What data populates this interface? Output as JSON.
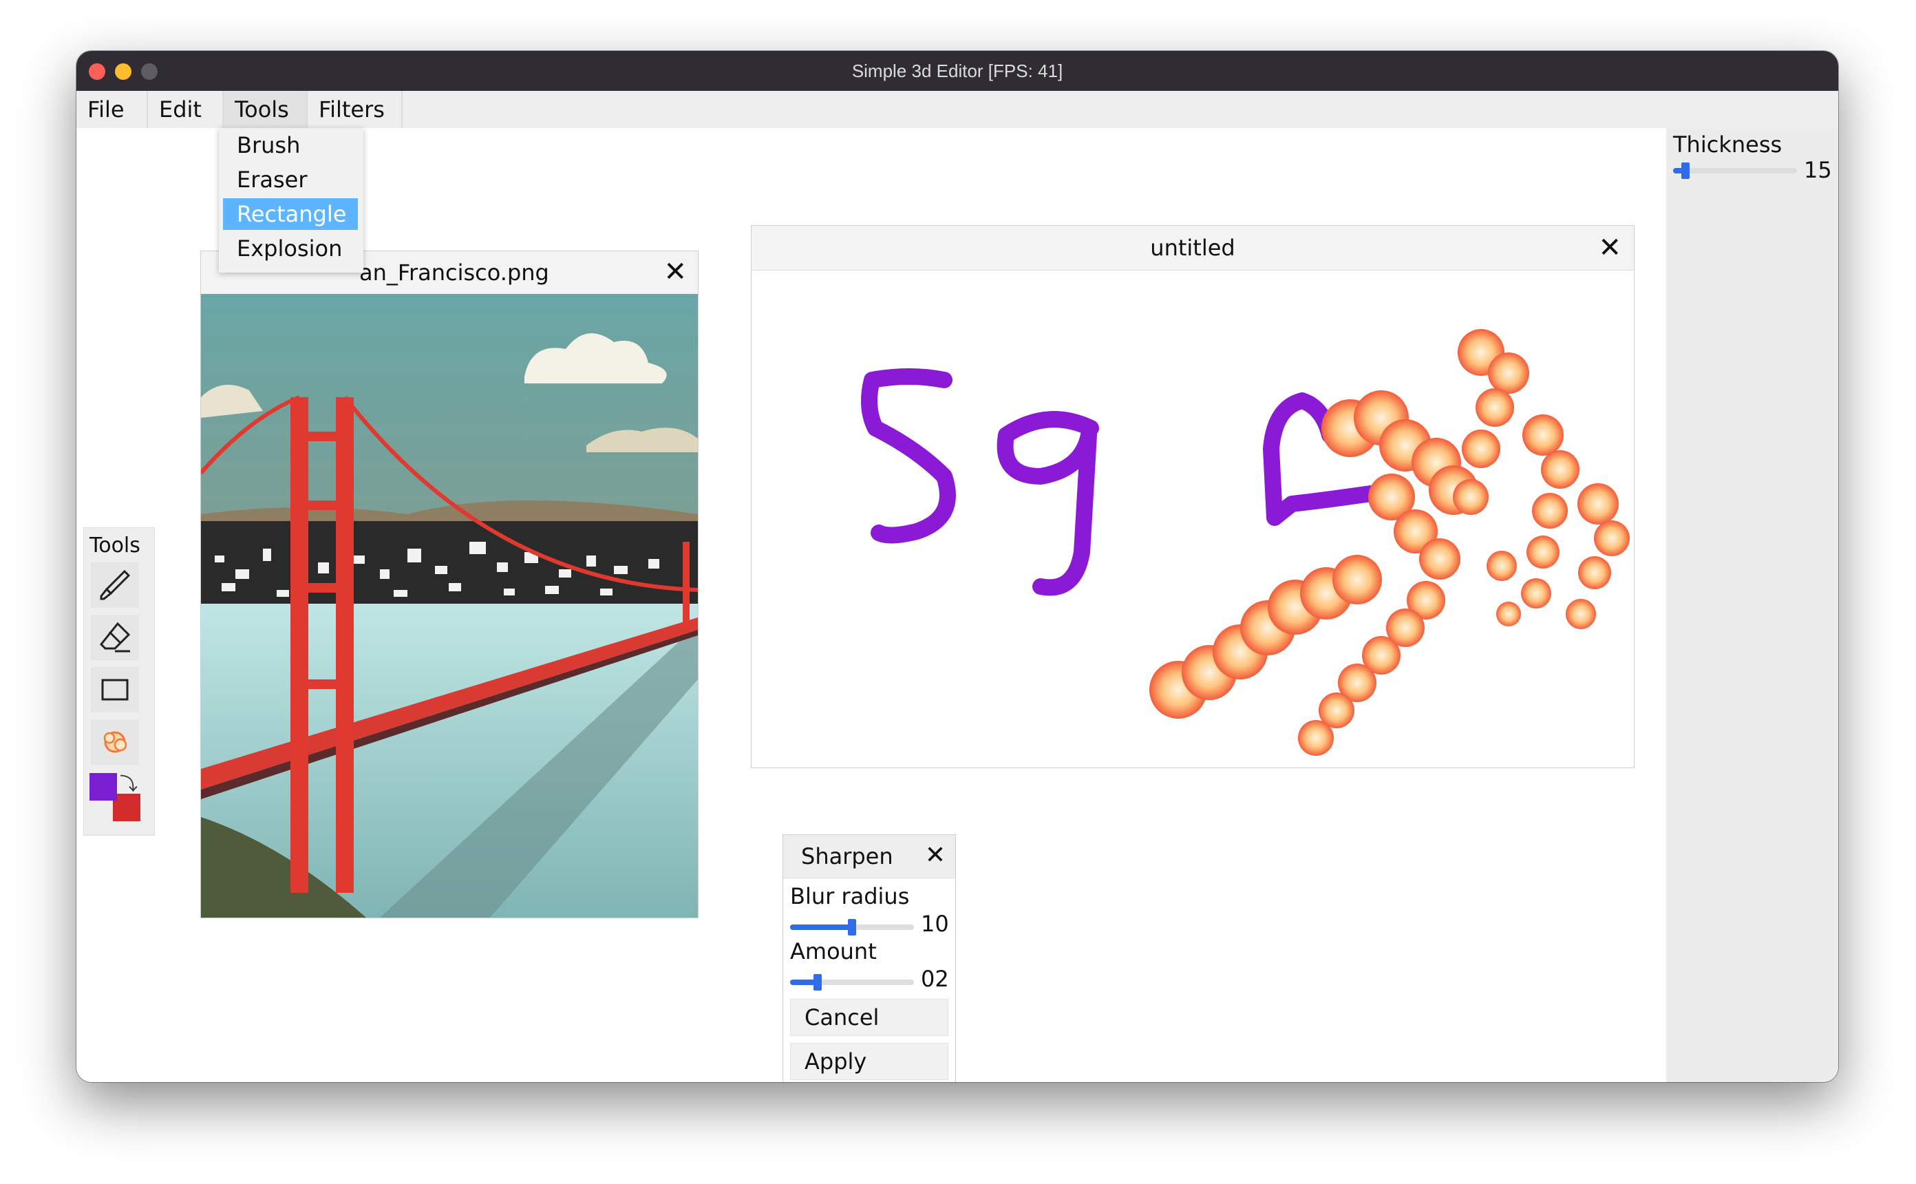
{
  "window": {
    "title": "Simple 3d Editor [FPS: 41]"
  },
  "menubar": {
    "items": [
      "File",
      "Edit",
      "Tools",
      "Filters"
    ],
    "active": "Tools"
  },
  "tools_menu": {
    "items": [
      "Brush",
      "Eraser",
      "Rectangle",
      "Explosion"
    ],
    "selected": "Rectangle"
  },
  "tools_panel": {
    "title": "Tools",
    "tools": [
      "brush-icon",
      "eraser-icon",
      "rectangle-icon",
      "explosion-icon"
    ],
    "foreground_color": "#7a1ed1",
    "background_color": "#d32b2b"
  },
  "image_window": {
    "title": "an_Francisco.png"
  },
  "document_window": {
    "title": "untitled",
    "stroke_color": "#8a1ad6"
  },
  "sharpen_dialog": {
    "title": "Sharpen",
    "blur_radius_label": "Blur radius",
    "blur_radius_value": "10",
    "blur_radius_fraction": 0.5,
    "amount_label": "Amount",
    "amount_value": "02",
    "amount_fraction": 0.22,
    "cancel_label": "Cancel",
    "apply_label": "Apply"
  },
  "thickness_panel": {
    "label": "Thickness",
    "value": "15",
    "fraction": 0.1
  }
}
